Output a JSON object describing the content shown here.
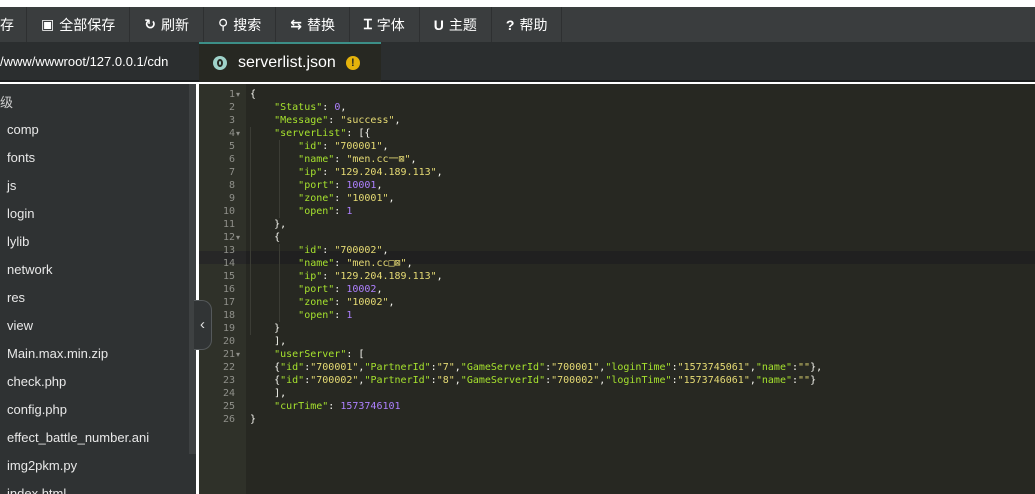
{
  "toolbar": {
    "items": [
      {
        "label": "存",
        "icon": ""
      },
      {
        "label": "全部保存",
        "icon": "▣"
      },
      {
        "label": "刷新",
        "icon": "↻"
      },
      {
        "label": "搜索",
        "icon": "⚲"
      },
      {
        "label": "替换",
        "icon": "⇆"
      },
      {
        "label": "字体",
        "icon": "Ɪ"
      },
      {
        "label": "主题",
        "icon": "U"
      },
      {
        "label": "帮助",
        "icon": "?"
      }
    ]
  },
  "breadcrumb": "/www/wwwroot/127.0.0.1/cdn",
  "tab": {
    "label": "serverlist.json",
    "warning": "!"
  },
  "sidebar": {
    "header": "级",
    "items": [
      "comp",
      "fonts",
      "js",
      "login",
      "lylib",
      "network",
      "res",
      "view",
      "Main.max.min.zip",
      "check.php",
      "config.php",
      "effect_battle_number.ani",
      "img2pkm.py",
      "index.html"
    ]
  },
  "collapse_icon": "‹",
  "colors": {
    "key": "#a6e22e",
    "string": "#e6db74",
    "number": "#ae81ff",
    "punct": "#f8f8f2",
    "editor_bg": "#272822"
  },
  "editor": {
    "line_numbers": [
      "1",
      "2",
      "3",
      "4",
      "5",
      "6",
      "7",
      "8",
      "9",
      "10",
      "11",
      "12",
      "13",
      "14",
      "15",
      "16",
      "17",
      "18",
      "19",
      "20",
      "21",
      "22",
      "23",
      "24",
      "25",
      "26"
    ],
    "fold_markers": {
      "1": "▾",
      "4": "▾",
      "12": "▾",
      "21": "▾"
    },
    "code_lines": [
      [
        [
          "p",
          "{"
        ]
      ],
      [
        [
          "p",
          "    "
        ],
        [
          "k",
          "\"Status\""
        ],
        [
          "p",
          ": "
        ],
        [
          "n",
          "0"
        ],
        [
          "p",
          ","
        ]
      ],
      [
        [
          "p",
          "    "
        ],
        [
          "k",
          "\"Message\""
        ],
        [
          "p",
          ": "
        ],
        [
          "s",
          "\"success\""
        ],
        [
          "p",
          ","
        ]
      ],
      [
        [
          "p",
          "    "
        ],
        [
          "k",
          "\"serverList\""
        ],
        [
          "p",
          ": [{"
        ]
      ],
      [
        [
          "p",
          "        "
        ],
        [
          "k",
          "\"id\""
        ],
        [
          "p",
          ": "
        ],
        [
          "s",
          "\"700001\""
        ],
        [
          "p",
          ","
        ]
      ],
      [
        [
          "p",
          "        "
        ],
        [
          "k",
          "\"name\""
        ],
        [
          "p",
          ": "
        ],
        [
          "s",
          "\"men.cc一⊠\""
        ],
        [
          "p",
          ","
        ]
      ],
      [
        [
          "p",
          "        "
        ],
        [
          "k",
          "\"ip\""
        ],
        [
          "p",
          ": "
        ],
        [
          "s",
          "\"129.204.189.113\""
        ],
        [
          "p",
          ","
        ]
      ],
      [
        [
          "p",
          "        "
        ],
        [
          "k",
          "\"port\""
        ],
        [
          "p",
          ": "
        ],
        [
          "n",
          "10001"
        ],
        [
          "p",
          ","
        ]
      ],
      [
        [
          "p",
          "        "
        ],
        [
          "k",
          "\"zone\""
        ],
        [
          "p",
          ": "
        ],
        [
          "s",
          "\"10001\""
        ],
        [
          "p",
          ","
        ]
      ],
      [
        [
          "p",
          "        "
        ],
        [
          "k",
          "\"open\""
        ],
        [
          "p",
          ": "
        ],
        [
          "n",
          "1"
        ]
      ],
      [
        [
          "p",
          "    },"
        ]
      ],
      [
        [
          "p",
          "    {"
        ]
      ],
      [
        [
          "p",
          "        "
        ],
        [
          "k",
          "\"id\""
        ],
        [
          "p",
          ": "
        ],
        [
          "s",
          "\"700002\""
        ],
        [
          "p",
          ","
        ]
      ],
      [
        [
          "p",
          "        "
        ],
        [
          "k",
          "\"name\""
        ],
        [
          "p",
          ": "
        ],
        [
          "s",
          "\"men.cc□⊠\""
        ],
        [
          "p",
          ","
        ]
      ],
      [
        [
          "p",
          "        "
        ],
        [
          "k",
          "\"ip\""
        ],
        [
          "p",
          ": "
        ],
        [
          "s",
          "\"129.204.189.113\""
        ],
        [
          "p",
          ","
        ]
      ],
      [
        [
          "p",
          "        "
        ],
        [
          "k",
          "\"port\""
        ],
        [
          "p",
          ": "
        ],
        [
          "n",
          "10002"
        ],
        [
          "p",
          ","
        ]
      ],
      [
        [
          "p",
          "        "
        ],
        [
          "k",
          "\"zone\""
        ],
        [
          "p",
          ": "
        ],
        [
          "s",
          "\"10002\""
        ],
        [
          "p",
          ","
        ]
      ],
      [
        [
          "p",
          "        "
        ],
        [
          "k",
          "\"open\""
        ],
        [
          "p",
          ": "
        ],
        [
          "n",
          "1"
        ]
      ],
      [
        [
          "p",
          "    }"
        ]
      ],
      [
        [
          "p",
          "    ],"
        ]
      ],
      [
        [
          "p",
          "    "
        ],
        [
          "k",
          "\"userServer\""
        ],
        [
          "p",
          ": ["
        ]
      ],
      [
        [
          "p",
          "    {"
        ],
        [
          "k",
          "\"id\""
        ],
        [
          "p",
          ":"
        ],
        [
          "s",
          "\"700001\""
        ],
        [
          "p",
          ","
        ],
        [
          "k",
          "\"PartnerId\""
        ],
        [
          "p",
          ":"
        ],
        [
          "s",
          "\"7\""
        ],
        [
          "p",
          ","
        ],
        [
          "k",
          "\"GameServerId\""
        ],
        [
          "p",
          ":"
        ],
        [
          "s",
          "\"700001\""
        ],
        [
          "p",
          ","
        ],
        [
          "k",
          "\"loginTime\""
        ],
        [
          "p",
          ":"
        ],
        [
          "s",
          "\"1573745061\""
        ],
        [
          "p",
          ","
        ],
        [
          "k",
          "\"name\""
        ],
        [
          "p",
          ":"
        ],
        [
          "s",
          "\"\""
        ],
        [
          "p",
          "},"
        ]
      ],
      [
        [
          "p",
          "    {"
        ],
        [
          "k",
          "\"id\""
        ],
        [
          "p",
          ":"
        ],
        [
          "s",
          "\"700002\""
        ],
        [
          "p",
          ","
        ],
        [
          "k",
          "\"PartnerId\""
        ],
        [
          "p",
          ":"
        ],
        [
          "s",
          "\"8\""
        ],
        [
          "p",
          ","
        ],
        [
          "k",
          "\"GameServerId\""
        ],
        [
          "p",
          ":"
        ],
        [
          "s",
          "\"700002\""
        ],
        [
          "p",
          ","
        ],
        [
          "k",
          "\"loginTime\""
        ],
        [
          "p",
          ":"
        ],
        [
          "s",
          "\"1573746061\""
        ],
        [
          "p",
          ","
        ],
        [
          "k",
          "\"name\""
        ],
        [
          "p",
          ":"
        ],
        [
          "s",
          "\"\""
        ],
        [
          "p",
          "}"
        ]
      ],
      [
        [
          "p",
          "    ],"
        ]
      ],
      [
        [
          "p",
          "    "
        ],
        [
          "k",
          "\"curTime\""
        ],
        [
          "p",
          ": "
        ],
        [
          "n",
          "1573746101"
        ]
      ],
      [
        [
          "p",
          "}"
        ]
      ]
    ]
  }
}
